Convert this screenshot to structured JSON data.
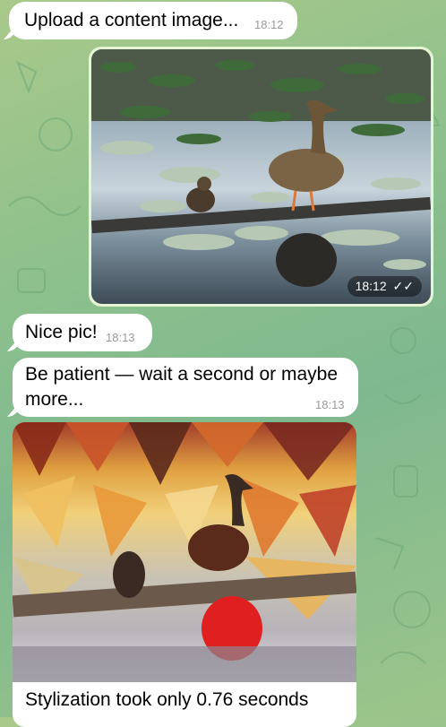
{
  "messages": {
    "upload_prompt": {
      "text": "Upload a content image...",
      "time": "18:12"
    },
    "user_photo": {
      "time": "18:12"
    },
    "nice_pic": {
      "text": "Nice pic!",
      "time": "18:13"
    },
    "patience": {
      "line1": "Be patient — wait a second or maybe",
      "line2": "more...",
      "time": "18:13"
    },
    "result": {
      "caption": "Stylization took only 0.76 seconds"
    }
  },
  "colors": {
    "wallpaper": "#8cc08d",
    "incoming_bubble": "#ffffff",
    "outgoing_bubble": "#e6f4d6",
    "timestamp": "#9a9a9a"
  },
  "icons": [
    "double-check-icon"
  ]
}
